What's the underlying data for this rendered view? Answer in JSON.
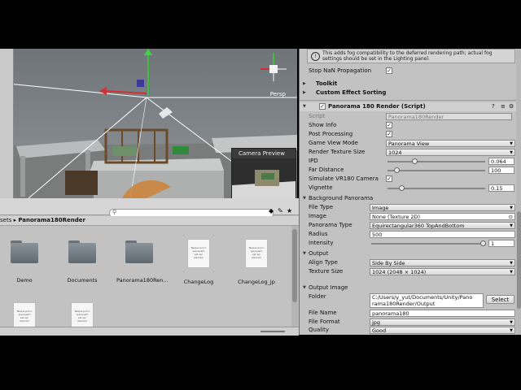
{
  "scene": {
    "persp_label": "Persp",
    "camera_preview_label": "Camera Preview"
  },
  "project": {
    "breadcrumb_prefix": "sets",
    "breadcrumb_sep": "▸",
    "breadcrumb_current": "Panorama180Render",
    "assets": [
      {
        "label": "Demo",
        "kind": "folder",
        "icon": "folder-icon"
      },
      {
        "label": "Documents",
        "kind": "folder",
        "icon": "folder-icon"
      },
      {
        "label": "Panorama180Ren…",
        "kind": "folder",
        "icon": "folder-icon"
      },
      {
        "label": "ChangeLog",
        "kind": "doc",
        "icon": "text-file-icon"
      },
      {
        "label": "ChangeLog_jp",
        "kind": "doc",
        "icon": "text-file-icon"
      },
      {
        "label": "",
        "kind": "doc",
        "icon": "text-file-icon"
      },
      {
        "label": "",
        "kind": "doc",
        "icon": "text-file-icon"
      }
    ],
    "doc_preview_text": "Neque porro quisquam est qui dolorem"
  },
  "inspector": {
    "help_text": "This adds fog compatibility to the deferred rendering path; actual fog settings should be set in the Lighting panel.",
    "stop_nan_label": "Stop NaN Propagation",
    "stop_nan_checked": true,
    "toolkit_label": "Toolkit",
    "custom_effect_label": "Custom Effect Sorting",
    "component_title": "Panorama 180 Render (Script)",
    "script_label": "Script",
    "script_value": "Panorama180Render",
    "show_info_label": "Show Info",
    "show_info_checked": true,
    "post_processing_label": "Post Processing",
    "post_processing_checked": true,
    "game_view_mode_label": "Game View Mode",
    "game_view_mode_value": "Panorama View",
    "render_tex_size_label": "Render Texture Size",
    "render_tex_size_value": "1024",
    "ipd_label": "IPD",
    "ipd_value": "0.064",
    "far_label": "Far Distance",
    "far_value": "100",
    "sim_vr_label": "Simulate VR180 Camera",
    "sim_vr_checked": true,
    "vignette_label": "Vignette",
    "vignette_value": "0.15",
    "bg_pano_header": "Background Panorama",
    "file_type_label": "File Type",
    "file_type_value": "Image",
    "image_label": "Image",
    "image_value": "None (Texture 2D)",
    "pano_type_label": "Panorama Type",
    "pano_type_value": "Equirectangular360 TopAndBottom",
    "radius_label": "Radius",
    "radius_value": "500",
    "intensity_label": "Intensity",
    "intensity_value": "1",
    "output_header": "Output",
    "align_label": "Align Type",
    "align_value": "Side By Side",
    "tex_size_label": "Texture Size",
    "tex_size_value": "1024 (2048 × 1024)",
    "output_image_header": "Output Image",
    "folder_label": "Folder",
    "folder_value_1": "C:/Users/y_yut/Documents/Unity/Pano",
    "folder_value_2": "rama180Render/Output",
    "select_label": "Select",
    "file_name_label": "File Name",
    "file_name_value": "panorama180",
    "file_format_label": "File Format",
    "file_format_value": "jpg",
    "quality_label": "Quality",
    "quality_value": "Good"
  }
}
